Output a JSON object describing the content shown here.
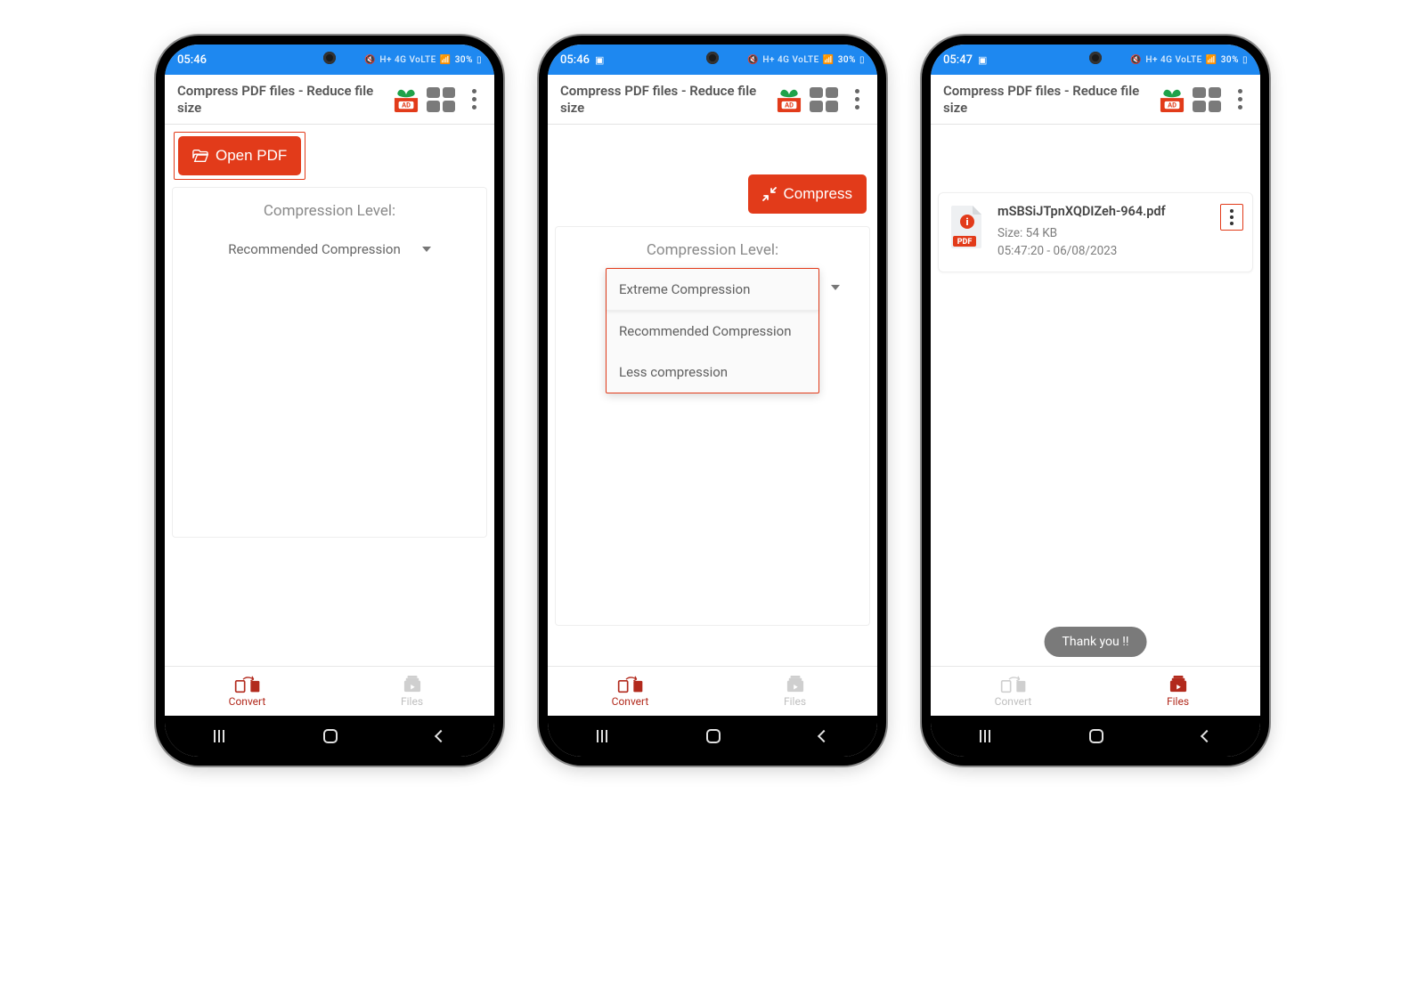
{
  "status": {
    "time_a": "05:46",
    "time_b": "05:46",
    "time_c": "05:47",
    "battery": "30%",
    "indicators": "H+ 4G VoLTE"
  },
  "app": {
    "title": "Compress PDF files - Reduce file size",
    "ad_label": "AD"
  },
  "screen1": {
    "open_pdf": "Open PDF",
    "section": "Compression Level:",
    "selected": "Recommended Compression"
  },
  "screen2": {
    "compress": "Compress",
    "section": "Compression Level:",
    "options": [
      "Extreme Compression",
      "Recommended Compression",
      "Less compression"
    ]
  },
  "screen3": {
    "file": {
      "name": "mSBSiJTpnXQDIZeh-964.pdf",
      "size": "Size: 54 KB",
      "ts": "05:47:20 - 06/08/2023"
    },
    "toast": "Thank you !!"
  },
  "nav": {
    "convert": "Convert",
    "files": "Files"
  }
}
